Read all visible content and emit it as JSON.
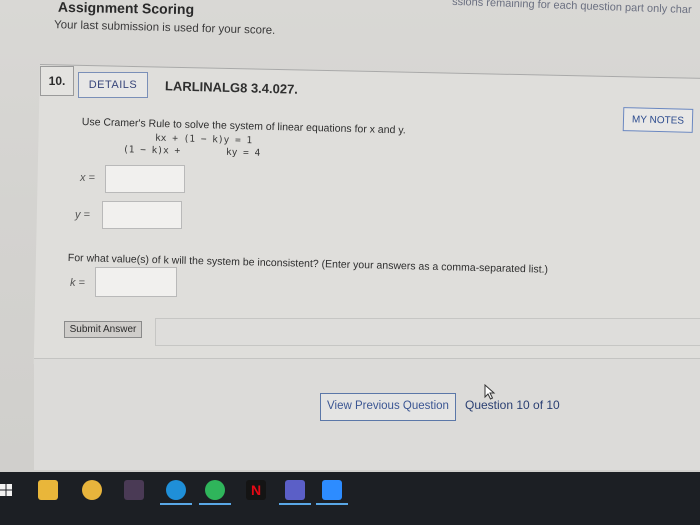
{
  "header": {
    "title": "Assignment Scoring",
    "remaining_text": "ssions remaining for each question part only char",
    "score_note": "Your last submission is used for your score."
  },
  "question": {
    "number": "10.",
    "details_label": "DETAILS",
    "code": "LARLINALG8 3.4.027.",
    "my_notes_label": "MY NOTES",
    "instruction": "Use Cramer's Rule to solve the system of linear equations for x and y.",
    "equation_1": "kx + (1 − k)y = 1",
    "equation_2": "(1 − k)x +        ky = 4",
    "x_label": "x =",
    "y_label": "y =",
    "k_question": "For what value(s) of k will the system be inconsistent? (Enter your answers as a comma-separated list.)",
    "k_label": "k =",
    "x_value": "",
    "y_value": "",
    "k_value": ""
  },
  "actions": {
    "submit_label": "Submit Answer"
  },
  "navigation": {
    "previous_label": "View Previous Question",
    "position_text": "Question 10 of 10"
  },
  "taskbar": {
    "icons": [
      "start-icon",
      "file-explorer-icon",
      "chrome-icon",
      "store-icon",
      "edge-icon",
      "spotify-icon",
      "netflix-icon",
      "teams-icon",
      "zoom-icon"
    ]
  },
  "colors": {
    "accent": "#3b5693",
    "taskbar": "#1c1f24"
  }
}
